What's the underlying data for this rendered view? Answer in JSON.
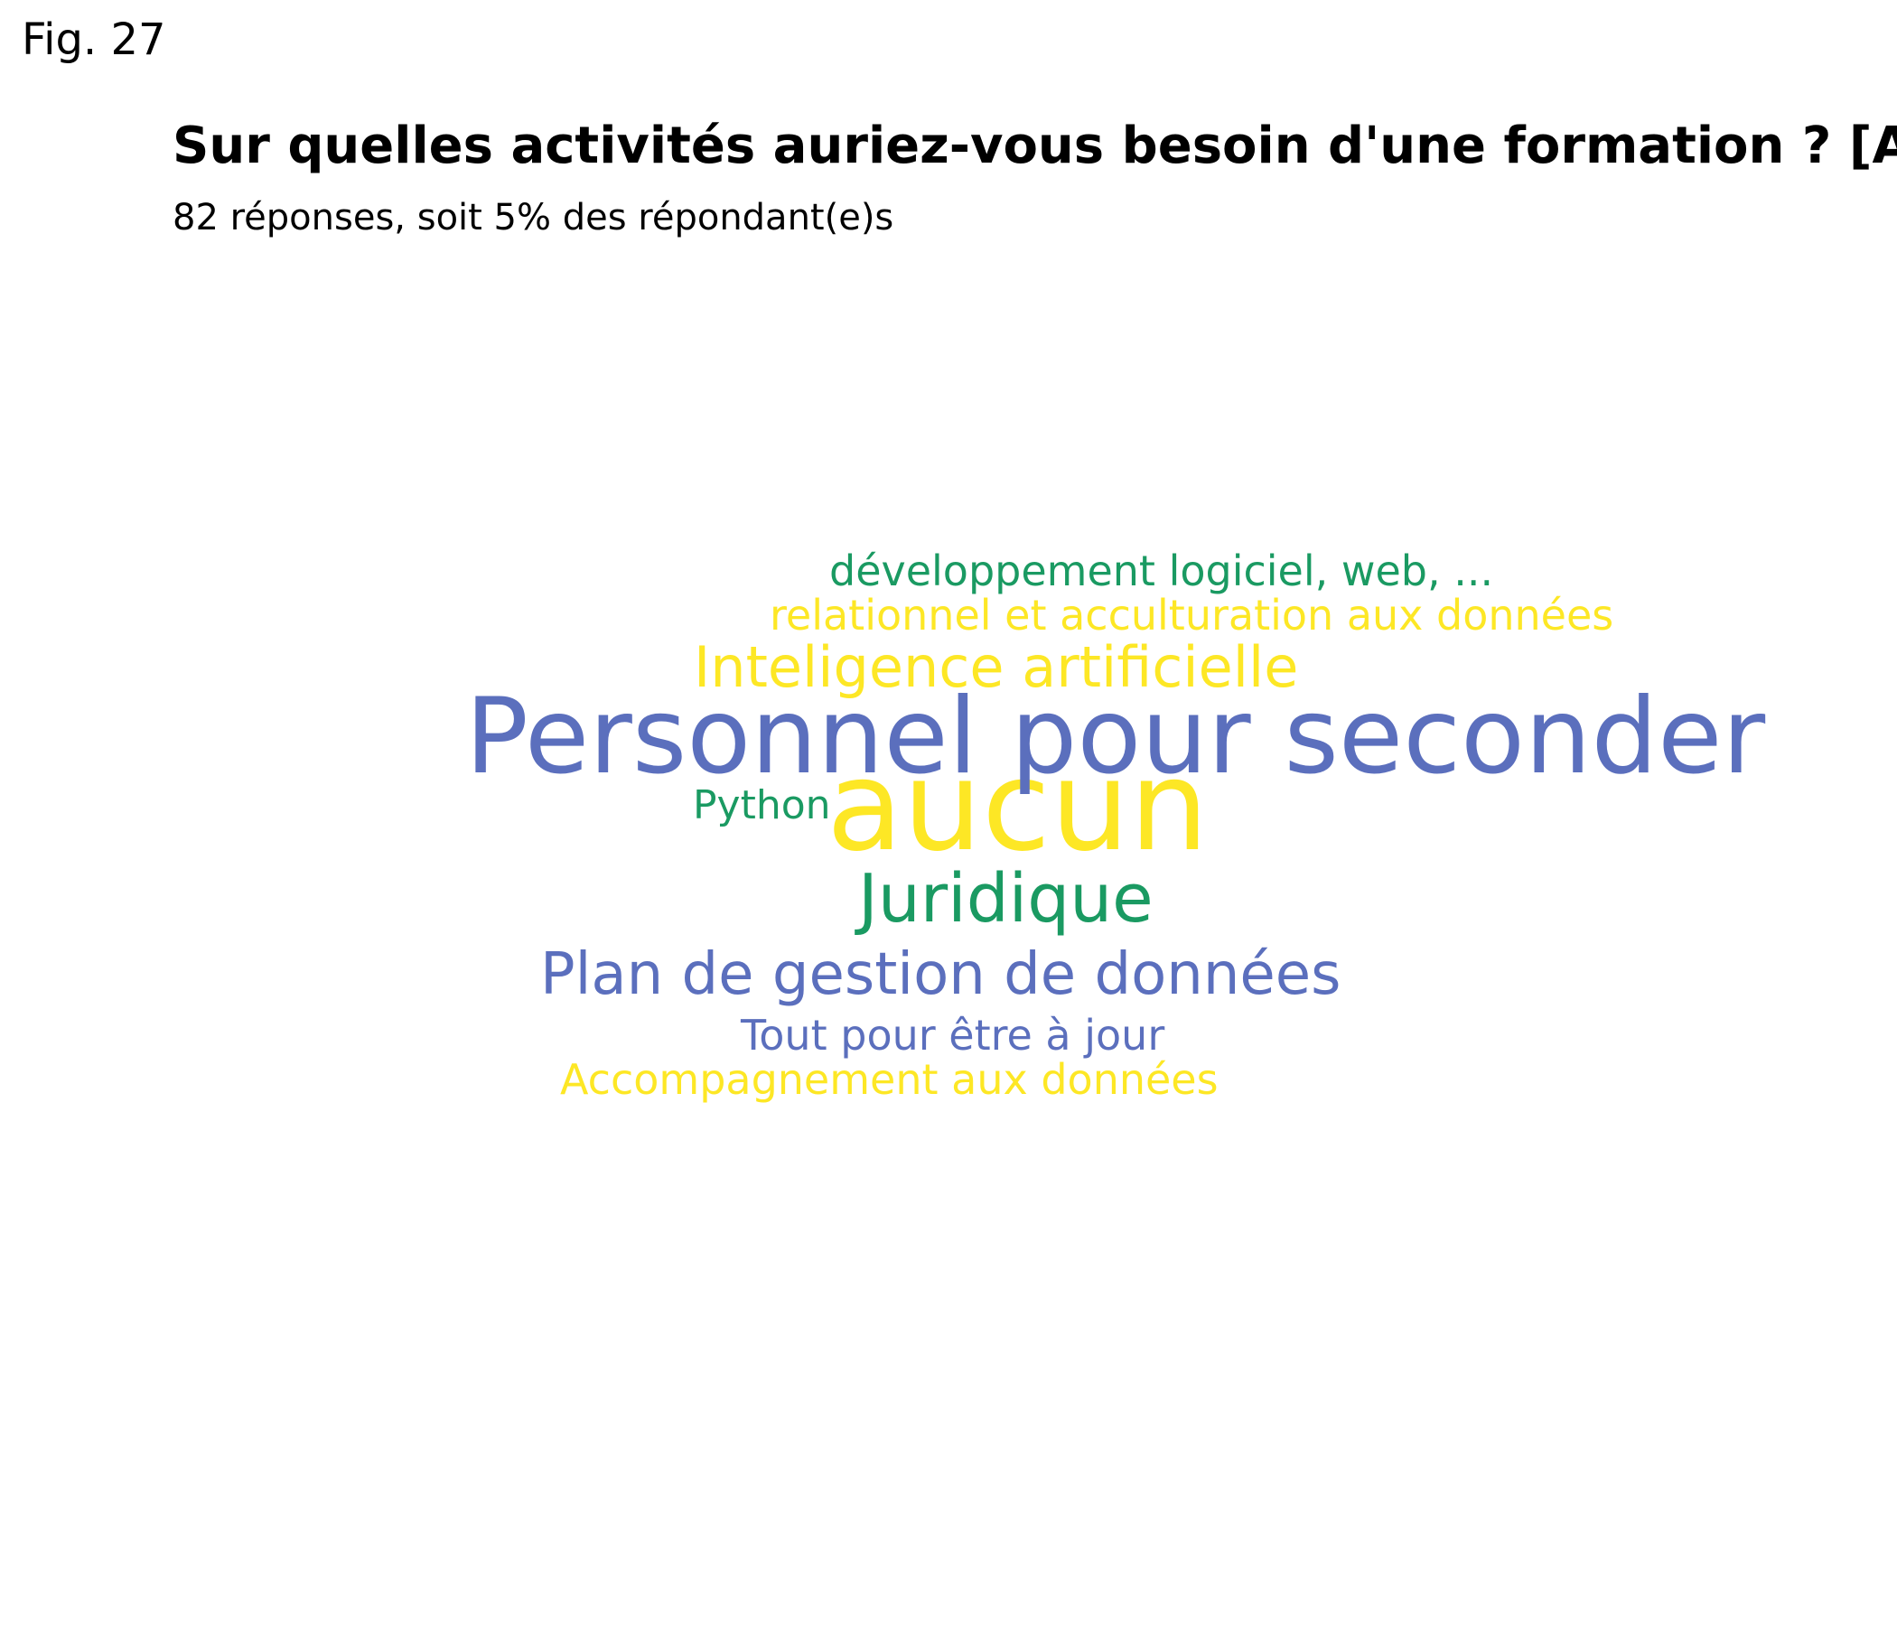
{
  "figure_label": "Fig. 27",
  "colors": {
    "blue": "#5b6fbd",
    "yellow": "#fde725",
    "green": "#1a9a62"
  },
  "chart_data": {
    "type": "wordcloud",
    "title": "Sur quelles activités auriez-vous besoin d'une formation ? [Au",
    "subtitle": "82 réponses, soit 5% des répondant(e)s",
    "words": [
      {
        "text": "aucun",
        "weight": 10,
        "color": "yellow"
      },
      {
        "text": "Personnel pour seconder",
        "weight": 8,
        "color": "blue"
      },
      {
        "text": "Juridique",
        "weight": 5,
        "color": "green"
      },
      {
        "text": "Plan de gestion de données",
        "weight": 4,
        "color": "blue"
      },
      {
        "text": "Inteligence artificielle",
        "weight": 4,
        "color": "yellow"
      },
      {
        "text": "développement logiciel, web, ...",
        "weight": 3,
        "color": "green"
      },
      {
        "text": "relationnel et acculturation aux données",
        "weight": 3,
        "color": "yellow"
      },
      {
        "text": "Python",
        "weight": 3,
        "color": "green"
      },
      {
        "text": "Tout pour être à jour",
        "weight": 3,
        "color": "blue"
      },
      {
        "text": "Accompagnement aux données",
        "weight": 3,
        "color": "yellow"
      }
    ]
  }
}
